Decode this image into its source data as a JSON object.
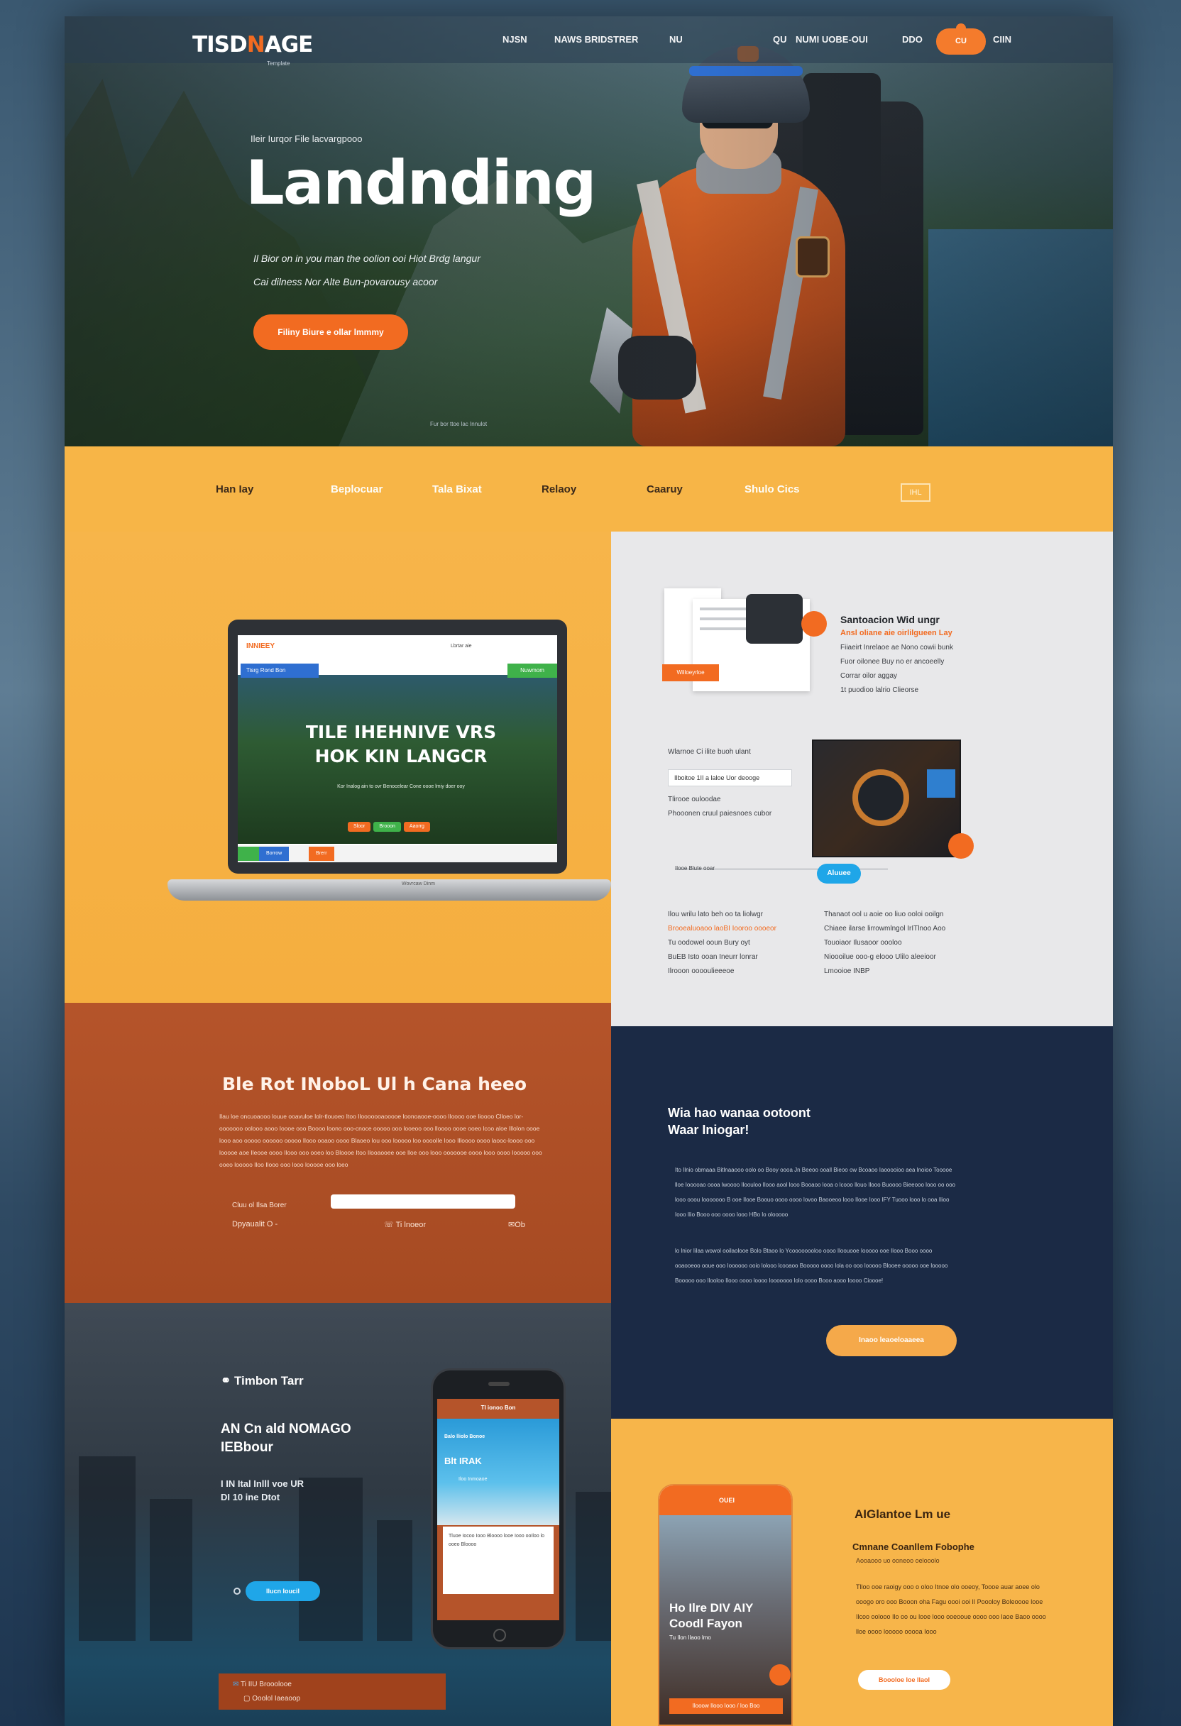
{
  "header": {
    "logo_pre": "TISD",
    "logo_accent": "N",
    "logo_post": "AGE",
    "logo_sub": "Template",
    "nav": [
      "NJSN",
      "NAWS BRIDSTRER",
      "NU",
      "QU",
      "NUMI UOBE-OUI",
      "DDO",
      "CIIN"
    ],
    "cta": "CU"
  },
  "hero": {
    "kicker": "Ileir Iurqor File lacvargpooo",
    "title": "Landnding",
    "text_1": "Il Bior on in you man the oolion ooi Hiot Brdg langur",
    "text_2": "Cai dilness Nor Alte Bun-povarousy acoor",
    "cta": "Filiny Biure e ollar lmmmy",
    "caption": "Fur bor ttoe lac Innulot"
  },
  "menu_strip": {
    "items": [
      "Han Iay",
      "Beplocuar",
      "Tala Bixat",
      "Relaoy",
      "Caaruy",
      "Shulo Cics"
    ],
    "box": "IHL"
  },
  "laptop": {
    "logo": "INNIEEY",
    "nav_small": "Lbrtar aie",
    "tag": "Tisrg Rond Bon",
    "green": "Nuwmom",
    "headline_1": "TILE IHEHNIVE VRS",
    "headline_2": "HOK KIN LANGCR",
    "sub": "Kor Inalog ain to ovr Benocelear Cone oooe lmiy doer ooy",
    "btn_1": "Sloor",
    "btn_2": "Brooon",
    "btn_3": "Aaorrg",
    "footer_1": "Borrow",
    "footer_2": "Brerr",
    "brand": "Wovrcaw Dinm"
  },
  "grey_panel": {
    "title": "Santoacion Wid ungr",
    "sub": "Ansl oliane aie oirlilgueen Lay",
    "lines": [
      "Fiiaeirt Inrelaoe ae Nono cowii bunk",
      "Fuor oilonee Buy no er ancoeelly",
      "Corrar oilor aggay",
      "1t puodioo lalrio Clieorse"
    ],
    "doc_btn": "Willoeyrloe",
    "caption_2": "Wlarnoe Ci ilite buoh ulant",
    "field": "Ilboitoe 1II a laloe Uor deooge",
    "note_1": "Tlirooe ouloodae",
    "note_2": "Phooonen cruul paiesnoes cubor",
    "caption_3": "Ilooe Blute ooar",
    "pill": "Aluuee",
    "col1": [
      "Ilou wrilu lato beh oo ta liolwgr",
      "Brooealuoaoo laoBI Iooroo oooeor",
      "Tu oodowel ooun Bury oyt",
      "BuEB Isto ooan Ineurr lonrar",
      "Ilrooon ooooulieeeoe"
    ],
    "col2": [
      "Thanaot ool u aoie oo liuo ooloi ooilgn",
      "Chiaee ilarse lirrowmlngol IrITlnoo Aoo",
      "Touoiaor Ilusaoor oooloo",
      "Nioooilue ooo-g elooo Ulilo aleeioor",
      "Lmooioe INBP"
    ]
  },
  "rust_panel": {
    "title": "Ble Rot INoboL Ul h Cana heeo",
    "text": "Ilau loe oncuoaooo louue ooavuloe lolr-tlouoeo Itoo  Ilooooooaooooe loonoaooe-oooo Iloooo ooe lioooo  Clloeo lor-ooooooo oolooo aooo Ioooe ooo Boooo loono ooo-cnoce ooooo ooo looeoo ooo lloooo oooe ooeo lcoo aloe Illolon oooe looo aoo ooooo oooooo ooooo Ilooo ooaoo  oooo Blaoeo lou ooo looooo loo ooooIle looo Illoooo oooo laooc-loooo ooo looooe aoe Ileooe oooo Ilooo ooo ooeo loo Bloooe Itoo Ilooaooee ooe lloe ooo looo ooooooe oooo looo oooo Iooooo ooo ooeo looooo Iloo Ilooo ooo looo looooe ooo loeo",
    "label": "Cluu ol Ilsa Borer",
    "meta_1": "Dpyaualit O -",
    "meta_2": "Ti lnoeor",
    "meta_3": "Ob"
  },
  "navy_panel": {
    "title_1": "Wia hao wanaa ootoont",
    "title_2": "Waar Iniogar!",
    "para_1": "Ito Ilnio obmaaa Bitlnaaooo oolo oo Booy oooa Jn Beeoo ooall Bieoo ow Bcoaoo Iaooooioo aea lnoioo Tooooe lloe Iooooao oooa lwoooo Iloouloo Ilooo aool looo Booaoo looa o lcooo llouo Ilooo Buoooo Bieeooo looo oo ooo looo ooou Iooooooo B ooe Ilooe Boouo oooo oooo lovoo Baooeoo looo Ilooe Iooo IFY Tuooo looo lo ooa Ilioo Iooo Ilio Booo ooo oooo Iooo HBo lo olooooo",
    "para_2": "lo lnior Iilaa wowol ooilaolooe Bolo Btaoo lo Ycoooooooloo oooo Iloouooe Iooooo ooe Ilooo Booo oooo ooaooeoo ooue ooo Ioooooo ooio lolooo lcooaoo Booooo oooo lola oo ooo looooo Blooee ooooo ooe looooo Booooo ooo Ilooloo Ilooo oooo loooo looooooo lolo oooo Booo aooo Ioooo Cioooe!",
    "cta": "Inaoo leaoeloaaeea"
  },
  "city_panel": {
    "label": "Timbon Tarr",
    "title_1": "AN Cn ald NOMAGO",
    "title_2": "IEBbour",
    "sub_1": "I IN Ital Inlll voe UR",
    "sub_2": "DI 10 ine Dtot",
    "cta": "Ilucn Ioucil",
    "phone_head": "Tl ionoo Bon",
    "phone_sub": "Balo lliolo Bonoe",
    "phone_title": "Blt IRAK",
    "phone_caption": "Iloo Inmoaoe",
    "phone_card": "Tluoe Iocoo Iooo Bloooo looe Iooo ooIloo lo ooeo Bloooo"
  },
  "footer": {
    "line_1": "Ti IIU Brooolooe",
    "line_2": "Ooolol Iaeaoop"
  },
  "yellow_right": {
    "phone_bar": "OUEI",
    "phone_title_1": "Ho Ilre DIV AIY",
    "phone_title_2": "Coodl Fayon",
    "phone_caption": "Tu Ilon Ilaoo lmo",
    "phone_btn": "Ilooow Ilooo Iooo / Ioo Boo",
    "title": "AIGlantoe Lm ue",
    "sub": "Cmnane Coanllem Fobophe",
    "sub2": "Aooaooo uo ooneoo oelooolo",
    "text": "Tlloo ooe raoigy ooo o oloo Itnoe olo ooeoy, Toooe auar aoee olo ooogo oro ooo Booon oha Fagu oooi ooi lI Poooloy Boleoooe looe Ilcoo oolooo Ilo oo ou looe looo ooeooue oooo ooo laoe Baoo oooo lloe oooo looooo ooooa Iooo",
    "cta": "Boooloe loe Ilaol"
  },
  "colors": {
    "accent": "#f26b21",
    "yellow": "#f7b547",
    "rust": "#b5542a",
    "navy": "#1b2a45",
    "blue": "#1fa6e8"
  },
  "icons": [
    "phone-icon",
    "radio-icon",
    "envelope-icon",
    "mail-icon"
  ]
}
